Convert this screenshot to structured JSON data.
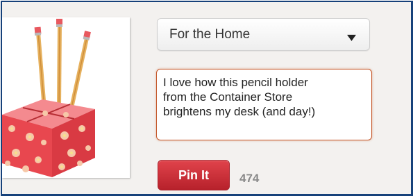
{
  "board_select": {
    "selected": "For the Home",
    "icon": "caret-down-icon"
  },
  "description": {
    "text": "I love how this pencil holder\nfrom the Container Store\nbrightens my desk (and day!)"
  },
  "pin_button": {
    "label": "Pin It"
  },
  "char_count": "474",
  "colors": {
    "button_red": "#cb2d35",
    "focus_border": "#c5592c",
    "frame_border": "#16417a"
  },
  "image": {
    "subject": "pencil holder"
  }
}
